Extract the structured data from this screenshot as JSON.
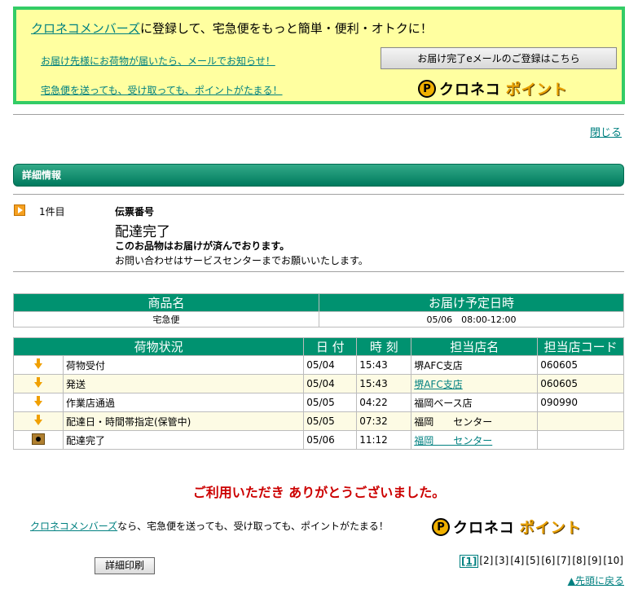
{
  "promo": {
    "headline_link": "クロネコメンバーズ",
    "headline_rest": "に登録して、宅急便をもっと簡単・便利・オトクに！",
    "line1": "お届け先様にお荷物が届いたら、メールでお知らせ！",
    "line2": "宅急便を送っても、受け取っても、ポイントがたまる！",
    "email_button": "お届け完了eメールのご登録はこちら"
  },
  "logo": {
    "badge": "P",
    "text1": "クロネコ",
    "text2": "ポイント"
  },
  "close_link": "閉じる",
  "section_title": "詳細情報",
  "item": {
    "index": "1件目",
    "slip_label": "伝票番号",
    "status_title": "配達完了",
    "status_message": "このお品物はお届けが済んでおります。",
    "status_note": "お問い合わせはサービスセンターまでお願いいたします。"
  },
  "product_table": {
    "headers": [
      "商品名",
      "お届け予定日時"
    ],
    "row": [
      "宅急便",
      "05/06　08:00-12:00"
    ]
  },
  "status_table": {
    "headers": [
      "荷物状況",
      "日 付",
      "時 刻",
      "担当店名",
      "担当店コード"
    ],
    "rows": [
      {
        "status": "荷物受付",
        "date": "05/04",
        "time": "15:43",
        "store": "堺AFC支店",
        "code": "060605",
        "icon": "down-arrow-icon"
      },
      {
        "status": "発送",
        "date": "05/04",
        "time": "15:43",
        "store": "堺AFC支店",
        "code": "060605",
        "icon": "down-arrow-icon"
      },
      {
        "status": "作業店通過",
        "date": "05/05",
        "time": "04:22",
        "store": "福岡ベース店",
        "code": "090990",
        "icon": "down-arrow-icon"
      },
      {
        "status": "配達日・時間帯指定(保管中)",
        "date": "05/05",
        "time": "07:32",
        "store": "福岡　　センター",
        "code": "",
        "icon": "down-arrow-icon"
      },
      {
        "status": "配達完了",
        "date": "05/06",
        "time": "11:12",
        "store": "福岡　　センター",
        "code": "",
        "icon": "package-icon"
      }
    ]
  },
  "thanks": "ご利用いただき ありがとうございました。",
  "promo2": {
    "link": "クロネコメンバーズ",
    "rest": "なら、宅急便を送っても、受け取っても、ポイントがたまる！"
  },
  "print_button": "詳細印刷",
  "pager": [
    "[1]",
    "[2]",
    "[3]",
    "[4]",
    "[5]",
    "[6]",
    "[7]",
    "[8]",
    "[9]",
    "[10]"
  ],
  "back_to_top": "▲先頭に戻る",
  "colors": {
    "accent": "#009270",
    "promo_bg": "#ffffa0",
    "promo_border": "#33cc66",
    "thanks": "#cc0000",
    "link": "#008080"
  }
}
